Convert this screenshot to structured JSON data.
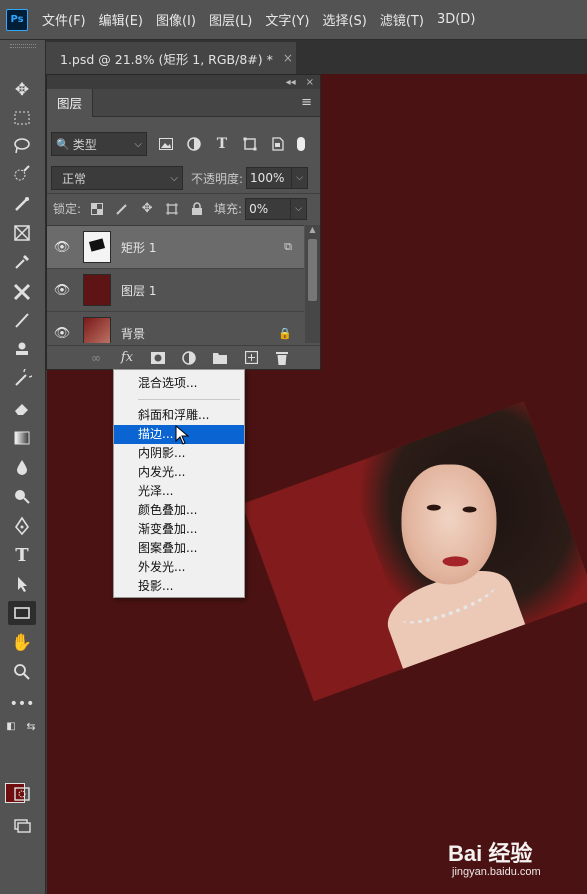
{
  "app": {
    "logo": "Ps"
  },
  "menu": [
    "文件(F)",
    "编辑(E)",
    "图像(I)",
    "图层(L)",
    "文字(Y)",
    "选择(S)",
    "滤镜(T)",
    "3D(D)"
  ],
  "document_tab": {
    "title": "1.psd @ 21.8% (矩形 1, RGB/8#) *",
    "close": "×"
  },
  "layers_panel": {
    "tab": "图层",
    "collapse": "◂◂",
    "close": "×",
    "menu_icon": "≡",
    "filter": {
      "value": "类型",
      "icons": [
        "image-filter-icon",
        "adjustment-filter-icon",
        "type-filter-icon",
        "shape-filter-icon",
        "smart-object-filter-icon"
      ]
    },
    "blend_mode": "正常",
    "opacity_label": "不透明度:",
    "opacity_value": "100%",
    "lock_label": "锁定:",
    "fill_label": "填充:",
    "fill_value": "0%",
    "layers": [
      {
        "name": "矩形 1",
        "selected": true,
        "badge": "⧉"
      },
      {
        "name": "图层 1",
        "selected": false,
        "badge": ""
      },
      {
        "name": "背景",
        "selected": false,
        "badge": "🔒"
      }
    ],
    "bottom_icons": [
      "link-icon",
      "fx-icon",
      "mask-icon",
      "adjustment-icon",
      "folder-icon",
      "new-layer-icon",
      "trash-icon"
    ],
    "fx_label": "fx"
  },
  "context_menu": {
    "items": [
      "混合选项...",
      "斜面和浮雕...",
      "描边...",
      "内阴影...",
      "内发光...",
      "光泽...",
      "颜色叠加...",
      "渐变叠加...",
      "图案叠加...",
      "外发光...",
      "投影..."
    ],
    "highlighted": "描边..."
  },
  "watermark": {
    "brand": "Bai 经验",
    "url": "jingyan.baidu.com"
  },
  "colors": {
    "canvas": "#4a1212",
    "foreground": "#6e0e0e",
    "background": "#ffffff",
    "highlight": "#0a64d2"
  }
}
